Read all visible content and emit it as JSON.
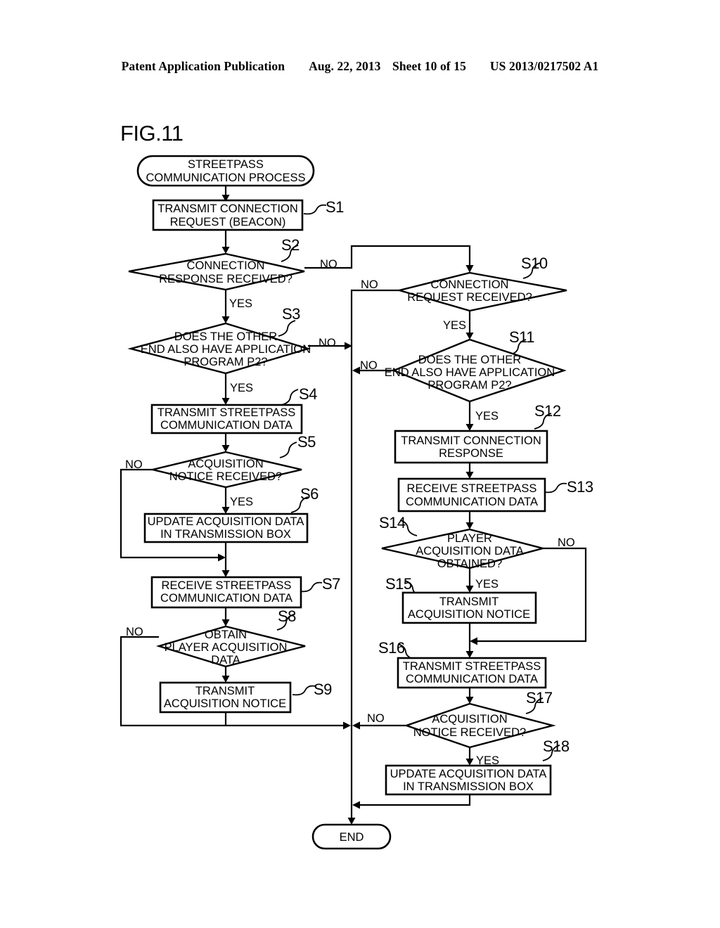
{
  "header": {
    "publication": "Patent Application Publication",
    "date": "Aug. 22, 2013",
    "sheet": "Sheet 10 of 15",
    "patent_number": "US 2013/0217502 A1"
  },
  "figure": {
    "label": "FIG.11"
  },
  "labels": {
    "yes": "YES",
    "no": "NO"
  },
  "nodes": {
    "start": {
      "id": "",
      "text_line1": "STREETPASS",
      "text_line2": "COMMUNICATION PROCESS"
    },
    "s1": {
      "id": "S1",
      "text_line1": "TRANSMIT CONNECTION",
      "text_line2": "REQUEST (BEACON)"
    },
    "s2": {
      "id": "S2",
      "text_line1": "CONNECTION",
      "text_line2": "RESPONSE RECEIVED?"
    },
    "s3": {
      "id": "S3",
      "text_line1": "DOES THE OTHER",
      "text_line2": "END ALSO HAVE APPLICATION",
      "text_line3": "PROGRAM P2?"
    },
    "s4": {
      "id": "S4",
      "text_line1": "TRANSMIT STREETPASS",
      "text_line2": "COMMUNICATION DATA"
    },
    "s5": {
      "id": "S5",
      "text_line1": "ACQUISITION",
      "text_line2": "NOTICE RECEIVED?"
    },
    "s6": {
      "id": "S6",
      "text_line1": "UPDATE ACQUISITION DATA",
      "text_line2": "IN TRANSMISSION BOX"
    },
    "s7": {
      "id": "S7",
      "text_line1": "RECEIVE STREETPASS",
      "text_line2": "COMMUNICATION DATA"
    },
    "s8": {
      "id": "S8",
      "text_line1": "OBTAIN",
      "text_line2": "PLAYER ACQUISITION",
      "text_line3": "DATA"
    },
    "s9": {
      "id": "S9",
      "text_line1": "TRANSMIT",
      "text_line2": "ACQUISITION NOTICE"
    },
    "s10": {
      "id": "S10",
      "text_line1": "CONNECTION",
      "text_line2": "REQUEST RECEIVED?"
    },
    "s11": {
      "id": "S11",
      "text_line1": "DOES THE OTHER",
      "text_line2": "END ALSO HAVE APPLICATION",
      "text_line3": "PROGRAM P2?"
    },
    "s12": {
      "id": "S12",
      "text_line1": "TRANSMIT CONNECTION",
      "text_line2": "RESPONSE"
    },
    "s13": {
      "id": "S13",
      "text_line1": "RECEIVE STREETPASS",
      "text_line2": "COMMUNICATION DATA"
    },
    "s14": {
      "id": "S14",
      "text_line1": "PLAYER",
      "text_line2": "ACQUISITION DATA",
      "text_line3": "OBTAINED?"
    },
    "s15": {
      "id": "S15",
      "text_line1": "TRANSMIT",
      "text_line2": "ACQUISITION NOTICE"
    },
    "s16": {
      "id": "S16",
      "text_line1": "TRANSMIT STREETPASS",
      "text_line2": "COMMUNICATION DATA"
    },
    "s17": {
      "id": "S17",
      "text_line1": "ACQUISITION",
      "text_line2": "NOTICE RECEIVED?"
    },
    "s18": {
      "id": "S18",
      "text_line1": "UPDATE ACQUISITION DATA",
      "text_line2": "IN TRANSMISSION BOX"
    },
    "end": {
      "id": "",
      "text_line1": "END"
    }
  },
  "branch_labels": {
    "s2_no": "NO",
    "s2_yes": "YES",
    "s3_no": "NO",
    "s3_yes": "YES",
    "s5_no": "NO",
    "s5_yes": "YES",
    "s8_no": "NO",
    "s10_no": "NO",
    "s10_yes": "YES",
    "s11_no": "NO",
    "s11_yes": "YES",
    "s14_no": "NO",
    "s14_yes": "YES",
    "s17_no": "NO",
    "s17_yes": "YES"
  }
}
